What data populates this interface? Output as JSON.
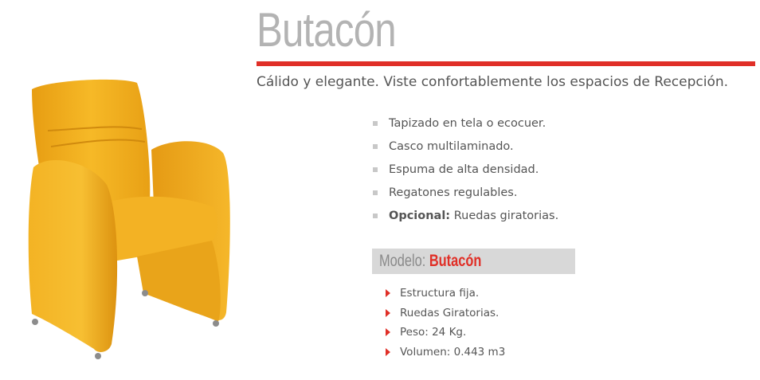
{
  "product": {
    "title": "Butacón",
    "tagline": "Cálido y elegante. Viste confortablemente los espacios de Recepción.",
    "image_icon": "yellow-armchair-illustration",
    "features": [
      {
        "bold": "",
        "text": "Tapizado en tela o ecocuer."
      },
      {
        "bold": "",
        "text": "Casco multilaminado."
      },
      {
        "bold": "",
        "text": "Espuma de alta densidad."
      },
      {
        "bold": "",
        "text": "Regatones regulables."
      },
      {
        "bold": "Opcional:",
        "text": " Ruedas giratorias."
      }
    ],
    "model": {
      "label": "Modelo:",
      "value": "Butacón"
    },
    "specs": [
      "Estructura fija.",
      "Ruedas Giratorias.",
      "Peso: 24 Kg.",
      "Volumen: 0.443 m3"
    ]
  },
  "colors": {
    "accent_red": "#e02f27",
    "title_gray": "#b3b3b3",
    "text_gray": "#555555",
    "model_bar": "#d8d8d8",
    "chair_yellow": "#f2b21e"
  }
}
